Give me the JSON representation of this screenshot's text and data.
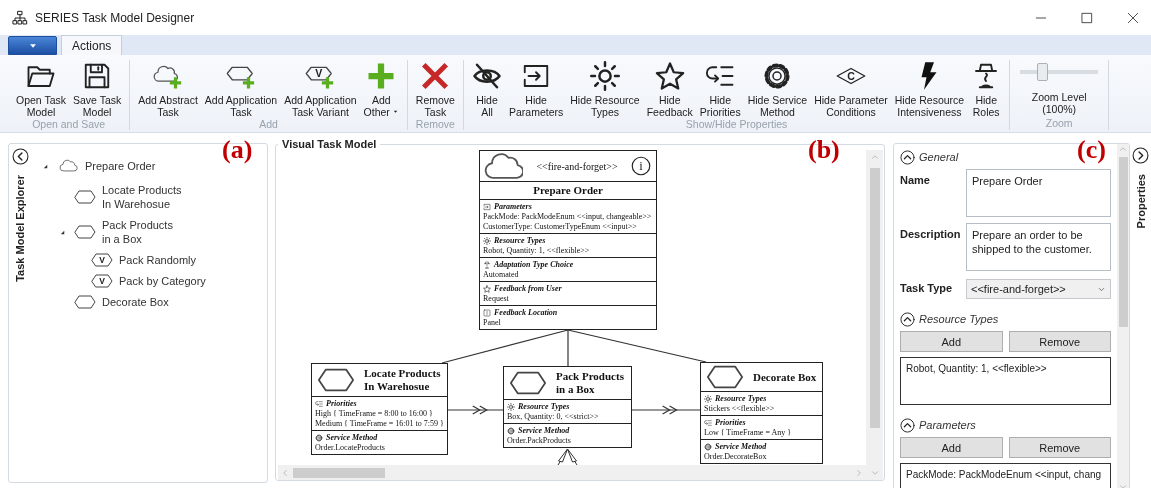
{
  "window": {
    "title": "SERIES Task Model Designer"
  },
  "ribbon_tabs": [
    {
      "label": "Actions",
      "selected": true
    }
  ],
  "ribbon_groups": [
    {
      "label": "Open and Save",
      "buttons": [
        {
          "kind": "open",
          "label": "Open Task\nModel"
        },
        {
          "kind": "save",
          "label": "Save Task\nModel"
        }
      ]
    },
    {
      "label": "Add",
      "buttons": [
        {
          "kind": "abstract",
          "label": "Add Abstract\nTask"
        },
        {
          "kind": "application",
          "label": "Add Application\nTask"
        },
        {
          "kind": "variant",
          "label": "Add Application\nTask Variant",
          "icon_letter": "V"
        },
        {
          "kind": "other",
          "label": "Add\nOther",
          "dropdown": true
        }
      ]
    },
    {
      "label": "Remove",
      "buttons": [
        {
          "kind": "remove",
          "label": "Remove\nTask"
        }
      ]
    },
    {
      "label": "Show/Hide Properties",
      "buttons": [
        {
          "kind": "hide_all",
          "label": "Hide\nAll"
        },
        {
          "kind": "parameters",
          "label": "Hide\nParameters"
        },
        {
          "kind": "resources",
          "label": "Hide Resource\nTypes"
        },
        {
          "kind": "feedback",
          "label": "Hide\nFeedback"
        },
        {
          "kind": "priorities",
          "label": "Hide\nPriorities"
        },
        {
          "kind": "service",
          "label": "Hide Service\nMethod"
        },
        {
          "kind": "conditions",
          "label": "Hide Parameter\nConditions",
          "icon_letter": "C"
        },
        {
          "kind": "intensiveness",
          "label": "Hide Resource\nIntensiveness"
        },
        {
          "kind": "roles",
          "label": "Hide\nRoles"
        }
      ]
    },
    {
      "label": "Zoom",
      "zoom": {
        "level": 0.25,
        "label": "Zoom Level\n(100%)"
      }
    }
  ],
  "explorer": {
    "title": "Task Model Explorer",
    "tree": [
      {
        "kind": "abstract",
        "label": "Prepare Order",
        "expanded": true,
        "children": [
          {
            "kind": "application",
            "label": "Locate Products\nIn Warehosue"
          },
          {
            "kind": "application",
            "label": "Pack Products\nin a Box",
            "expanded": true,
            "children": [
              {
                "kind": "variant",
                "label": "Pack Randomly",
                "icon_letter": "V"
              },
              {
                "kind": "variant",
                "label": "Pack by Category",
                "icon_letter": "V"
              }
            ]
          },
          {
            "kind": "application",
            "label": "Decorate Box"
          }
        ]
      }
    ]
  },
  "diagram": {
    "title": "Visual Task Model",
    "root": {
      "kind": "abstract",
      "stereotype": "<<fire-and-forget>>",
      "info_mark": "i",
      "name": "Prepare Order",
      "sections": [
        {
          "kind": "parameters",
          "title": "Parameters",
          "lines": [
            "PackMode: PackModeEnum <<input, changeable>>",
            "CustomerType: CustomerTypeEnum <<input>>"
          ]
        },
        {
          "kind": "resources",
          "title": "Resource Types",
          "lines": [
            "Robot, Quantity: 1, <<flexible>>"
          ]
        },
        {
          "kind": "adaptation",
          "title": "Adaptation Type Choice",
          "lines": [
            "Automated"
          ]
        },
        {
          "kind": "feedback",
          "title": "Feedback from User",
          "lines": [
            "Request"
          ]
        },
        {
          "kind": "location",
          "title": "Feedback Location",
          "lines": [
            "Panel"
          ]
        }
      ]
    },
    "children": [
      {
        "kind": "application",
        "name": "Locate Products\nIn Warehosue",
        "sections": [
          {
            "kind": "priorities",
            "title": "Priorities",
            "lines": [
              "High { TimeFrame = 8:00 to 16:00 }",
              "Medium { TimeFrame = 16:01 to 7:59 }"
            ]
          },
          {
            "kind": "service",
            "title": "Service Method",
            "lines": [
              "Order.LocateProducts"
            ]
          }
        ]
      },
      {
        "kind": "application",
        "name": "Pack Products\nin a Box",
        "sections": [
          {
            "kind": "resources",
            "title": "Resource Types",
            "lines": [
              "Box, Quantity: 0, <<strict>>"
            ]
          },
          {
            "kind": "service",
            "title": "Service Method",
            "lines": [
              "Order.PackProducts"
            ]
          }
        ]
      },
      {
        "kind": "application",
        "name": "Decorate Box",
        "sections": [
          {
            "kind": "resources",
            "title": "Resource Types",
            "lines": [
              "Stickers <<flexible>>"
            ]
          },
          {
            "kind": "priorities",
            "title": "Priorities",
            "lines": [
              "Low { TimeFrame = Any }"
            ]
          },
          {
            "kind": "service",
            "title": "Service Method",
            "lines": [
              "Order.DecorateBox"
            ]
          }
        ]
      }
    ]
  },
  "properties": {
    "title": "Properties",
    "sections": [
      {
        "kind": "general",
        "title": "General",
        "expanded": true,
        "fields": [
          {
            "kind": "text",
            "label": "Name",
            "value": "Prepare Order"
          },
          {
            "kind": "text",
            "label": "Description",
            "value": "Prepare an order to be shipped to the customer."
          },
          {
            "kind": "select",
            "label": "Task Type",
            "value": "<<fire-and-forget>>"
          }
        ]
      },
      {
        "kind": "list",
        "title": "Resource Types",
        "expanded": true,
        "buttons": [
          "Add",
          "Remove"
        ],
        "items": [
          "Robot, Quantity: 1, <<flexible>>"
        ]
      },
      {
        "kind": "list",
        "title": "Parameters",
        "expanded": true,
        "buttons": [
          "Add",
          "Remove"
        ],
        "items": [
          "PackMode: PackModeEnum <<input, chang"
        ]
      }
    ]
  },
  "annotations": [
    "(a)",
    "(b)",
    "(c)"
  ]
}
